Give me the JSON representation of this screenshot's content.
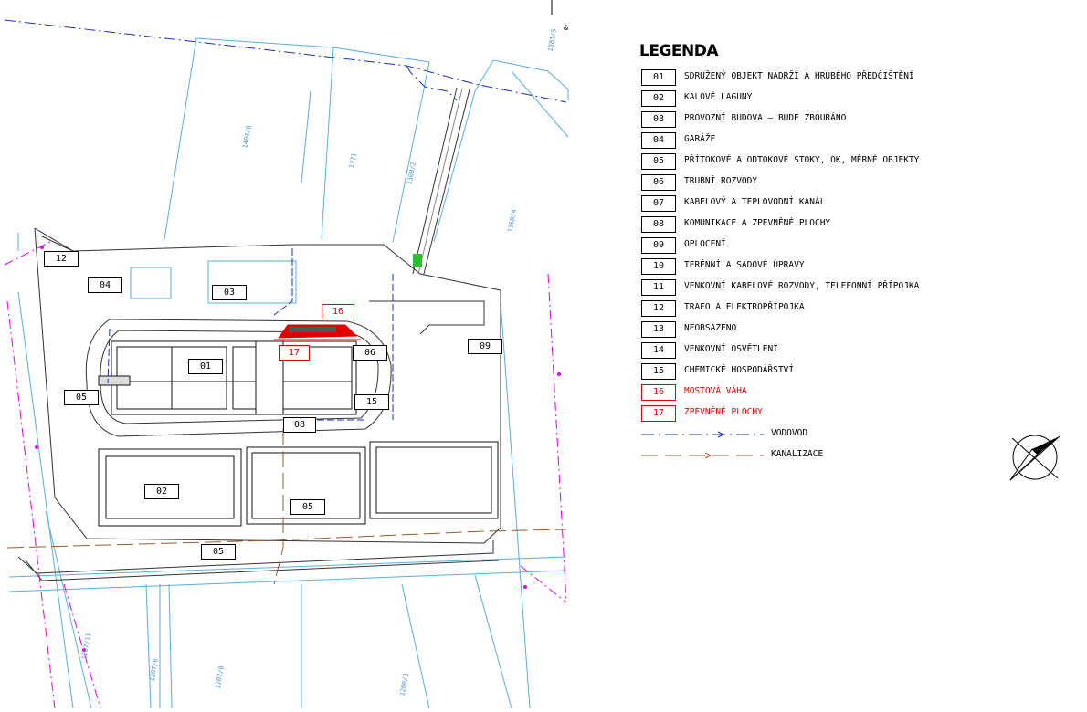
{
  "legend": {
    "title": "LEGENDA",
    "items": [
      {
        "code": "01",
        "text": "SDRUŽENÝ OBJEKT NÁDRŽÍ A HRUBÉHO PŘEDČIŠTĚNÍ",
        "color": "#000000"
      },
      {
        "code": "02",
        "text": "KALOVÉ LAGUNY",
        "color": "#000000"
      },
      {
        "code": "03",
        "text": "PROVOZNÍ BUDOVA – BUDE ZBOURÁNO",
        "color": "#000000"
      },
      {
        "code": "04",
        "text": "GARÁŽE",
        "color": "#000000"
      },
      {
        "code": "05",
        "text": "PŘÍTOKOVÉ A ODTOKOVÉ STOKY, OK, MĚRNÉ OBJEKTY",
        "color": "#000000"
      },
      {
        "code": "06",
        "text": "TRUBNÍ ROZVODY",
        "color": "#000000"
      },
      {
        "code": "07",
        "text": "KABELOVÝ A TEPLOVODNÍ KANÁL",
        "color": "#000000"
      },
      {
        "code": "08",
        "text": "KOMUNIKACE A ZPEVNĚNÉ PLOCHY",
        "color": "#000000"
      },
      {
        "code": "09",
        "text": "OPLOCENÍ",
        "color": "#000000"
      },
      {
        "code": "10",
        "text": "TERÉNNÍ A SADOVÉ ÚPRAVY",
        "color": "#000000"
      },
      {
        "code": "11",
        "text": "VENKOVNÍ KABELOVÉ ROZVODY, TELEFONNÍ PŘÍPOJKA",
        "color": "#000000"
      },
      {
        "code": "12",
        "text": "TRAFO A ELEKTROPŘÍPOJKA",
        "color": "#000000"
      },
      {
        "code": "13",
        "text": "NEOBSAZENO",
        "color": "#000000"
      },
      {
        "code": "14",
        "text": "VENKOVNÍ OSVĚTLENÍ",
        "color": "#000000"
      },
      {
        "code": "15",
        "text": "CHEMICKÉ HOSPODÁŘSTVÍ",
        "color": "#000000"
      },
      {
        "code": "16",
        "text": "MOSTOVÁ VÁHA",
        "color": "#e00000"
      },
      {
        "code": "17",
        "text": "ZPEVNĚNÉ PLOCHY",
        "color": "#e00000"
      }
    ],
    "lines": [
      {
        "label": "VODOVOD",
        "color": "#1a2fb8",
        "style": "dash-dot"
      },
      {
        "label": "KANALIZACE",
        "color": "#9a5a2a",
        "style": "dash"
      }
    ]
  },
  "map": {
    "labels": {
      "l01": "01",
      "l02": "02",
      "l03": "03",
      "l04": "04",
      "l05a": "05",
      "l05b": "05",
      "l05c": "05",
      "l06": "06",
      "l08": "08",
      "l09": "09",
      "l12": "12",
      "l15": "15",
      "l16": "16",
      "l17": "17"
    },
    "parcels": {
      "p1": "1404/8",
      "p2": "1371",
      "p3": "1369/2",
      "p4": "1368/4",
      "p5": "1381/5",
      "p6": "1207/8",
      "p7": "1207/6",
      "p8": "1206/3",
      "p9": "1207/11"
    },
    "misc_amp": "&",
    "colors": {
      "parcel": "#5aaee0",
      "water": "#1a2fb8",
      "sewer": "#9a5a2a",
      "fence": "#e000e0",
      "accent": "#e00000",
      "green": "#2ec02e"
    }
  }
}
